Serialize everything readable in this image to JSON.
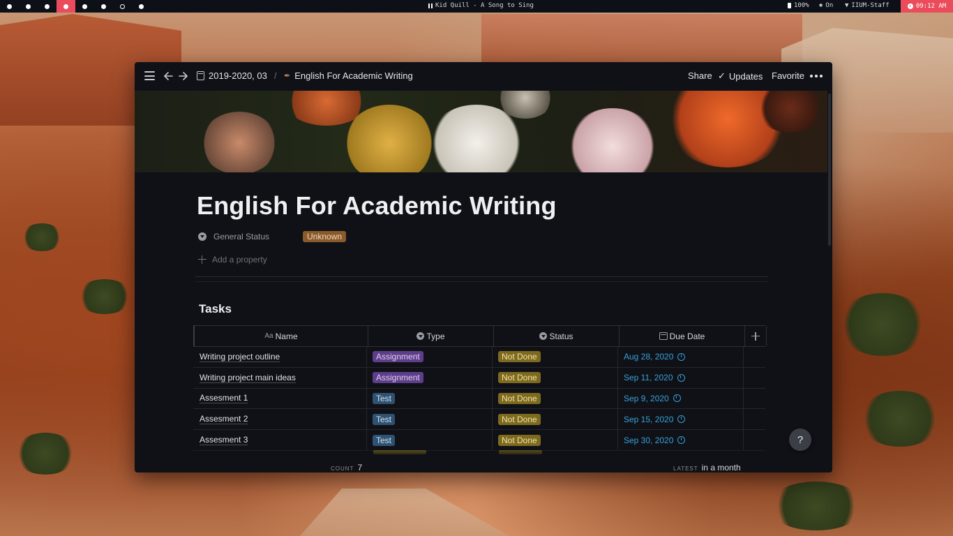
{
  "topbar": {
    "workspaces": [
      {
        "state": "filled"
      },
      {
        "state": "filled"
      },
      {
        "state": "filled"
      },
      {
        "state": "active"
      },
      {
        "state": "filled"
      },
      {
        "state": "filled"
      },
      {
        "state": "hollow"
      },
      {
        "state": "filled"
      }
    ],
    "now_playing": "Kid Quill - A Song to Sing",
    "battery": "100%",
    "bluetooth": "On",
    "wifi": "IIUM-Staff",
    "clock": "09:12 AM",
    "accent_color": "#ea4c5c"
  },
  "window": {
    "breadcrumb": {
      "parent": "2019-2020, 03",
      "separator": "/",
      "current": "English For Academic Writing"
    },
    "actions": {
      "share": "Share",
      "updates": "Updates",
      "favorite": "Favorite"
    }
  },
  "page": {
    "title": "English For Academic Writing",
    "property": {
      "name": "General Status",
      "value": "Unknown"
    },
    "add_property": "Add a property"
  },
  "tasks": {
    "title": "Tasks",
    "columns": {
      "name": "Name",
      "type": "Type",
      "status": "Status",
      "due": "Due Date"
    },
    "rows": [
      {
        "name": "Writing project outline",
        "type": "Assignment",
        "status": "Not Done",
        "due": "Aug 28, 2020"
      },
      {
        "name": "Writing project main ideas",
        "type": "Assignment",
        "status": "Not Done",
        "due": "Sep 11, 2020"
      },
      {
        "name": "Assesment 1",
        "type": "Test",
        "status": "Not Done",
        "due": "Sep 9, 2020"
      },
      {
        "name": "Assesment 2",
        "type": "Test",
        "status": "Not Done",
        "due": "Sep 15, 2020"
      },
      {
        "name": "Assesment 3",
        "type": "Test",
        "status": "Not Done",
        "due": "Sep 30, 2020"
      }
    ],
    "footer": {
      "count_label": "COUNT",
      "count_value": "7",
      "latest_label": "LATEST",
      "latest_value": "in a month"
    }
  },
  "help_button": "?"
}
